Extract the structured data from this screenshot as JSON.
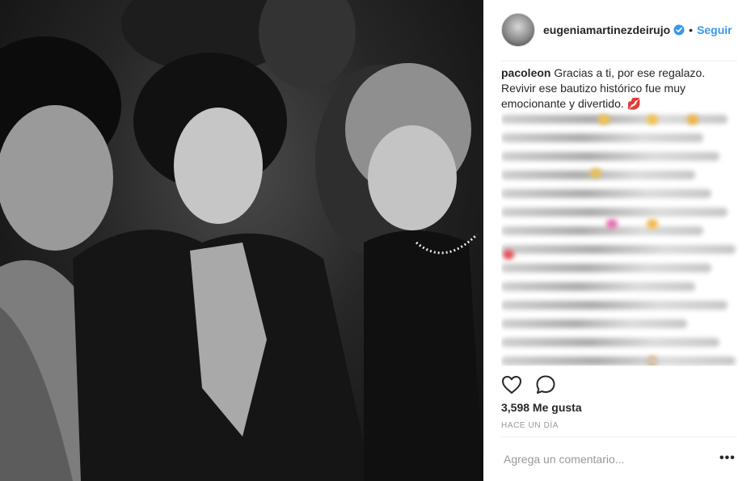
{
  "post": {
    "photo_alt": "",
    "author": {
      "username": "eugeniamartinezdeirujo",
      "separator": "•",
      "follow_label": "Seguir"
    },
    "comment": {
      "username": "pacoleon",
      "text": "Gracias a ti, por ese regalazo. Revivir ese bautizo histórico fue muy emocionante y divertido. 💋"
    },
    "likes": "3,598 Me gusta",
    "timestamp": "HACE UN DÍA",
    "add_comment_placeholder": "Agrega un comentario...",
    "more_label": "•••"
  },
  "colors": {
    "link": "#3897f0",
    "text": "#262626",
    "muted": "#999999",
    "verified": "#3897f0"
  },
  "icons": [
    "verified-badge-icon",
    "heart-icon",
    "comment-icon",
    "more-options-icon"
  ]
}
